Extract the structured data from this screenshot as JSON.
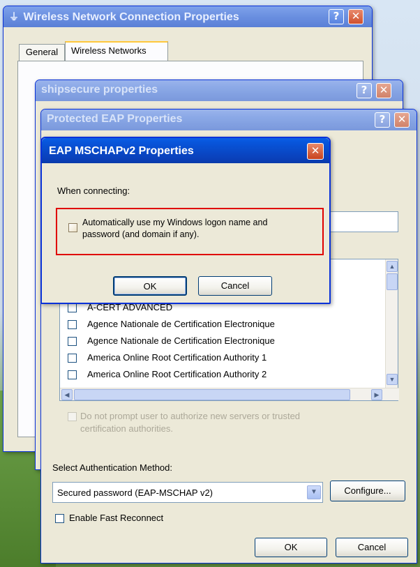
{
  "wireless_window": {
    "title": "Wireless Network Connection Properties",
    "tabs": [
      "General",
      "Wireless Networks"
    ],
    "help_glyph": "?",
    "close_glyph": "✕"
  },
  "ship_window": {
    "title": "shipsecure properties"
  },
  "peap_window": {
    "title": "Protected EAP Properties",
    "cert_list": [
      "A-CERT ADVANCED",
      "Agence Nationale de Certification Electronique",
      "Agence Nationale de Certification Electronique",
      "America Online Root Certification Authority 1",
      "America Online Root Certification Authority 2"
    ],
    "do_not_prompt_label_1": "Do not prompt user to authorize new servers or trusted",
    "do_not_prompt_label_2": "certification authorities.",
    "auth_method_label": "Select Authentication Method:",
    "auth_method_value": "Secured password (EAP-MSCHAP v2)",
    "configure_button": "Configure...",
    "fast_reconnect_label": "Enable Fast Reconnect",
    "ok_button": "OK",
    "cancel_button": "Cancel"
  },
  "mschap_dialog": {
    "title": "EAP MSCHAPv2 Properties",
    "when_connecting": "When connecting:",
    "auto_logon_line1": "Automatically use my Windows logon name and",
    "auto_logon_line2": "password (and domain if any).",
    "ok_button": "OK",
    "cancel_button": "Cancel"
  },
  "colors": {
    "highlight_box": "#e00000",
    "xp_blue": "#0a3fb8"
  }
}
